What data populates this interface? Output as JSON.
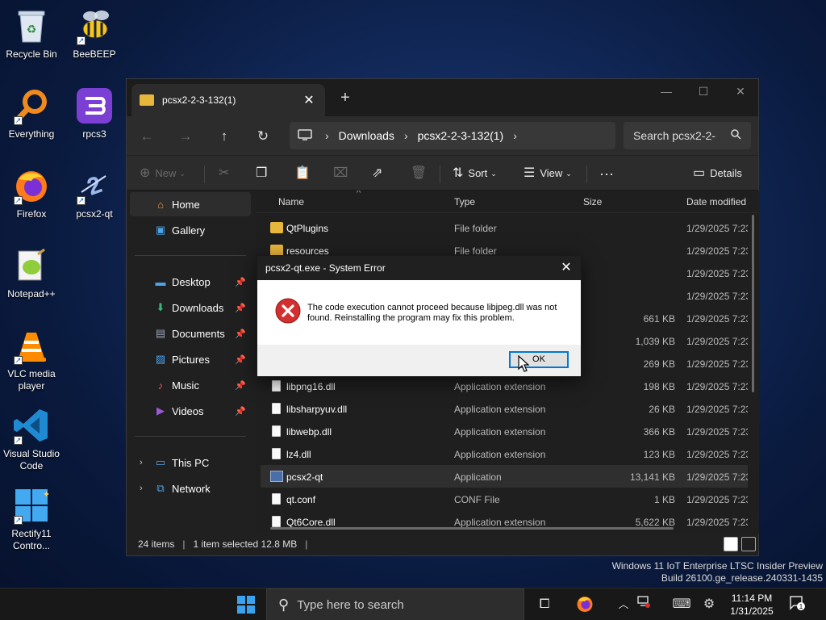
{
  "desktop": {
    "icons": [
      {
        "label": "Recycle Bin",
        "icon": "recycle-bin-icon"
      },
      {
        "label": "BeeBEEP",
        "icon": "beebeep-icon"
      },
      {
        "label": "Everything",
        "icon": "everything-icon"
      },
      {
        "label": "rpcs3",
        "icon": "rpcs3-icon"
      },
      {
        "label": "Firefox",
        "icon": "firefox-icon"
      },
      {
        "label": "pcsx2-qt",
        "icon": "pcsx2-icon"
      },
      {
        "label": "Notepad++",
        "icon": "notepadpp-icon"
      },
      {
        "label": "VLC media player",
        "icon": "vlc-icon"
      },
      {
        "label": "Visual Studio Code",
        "icon": "vscode-icon"
      },
      {
        "label": "Rectify11 Contro...",
        "icon": "rectify11-icon"
      }
    ]
  },
  "explorer": {
    "tab_title": "pcsx2-2-3-132(1)",
    "address": {
      "crumbs": [
        "Downloads",
        "pcsx2-2-3-132(1)"
      ]
    },
    "search_placeholder": "Search pcsx2-2-",
    "commands": {
      "new": "New",
      "sort": "Sort",
      "view": "View",
      "details": "Details"
    },
    "sidebar": {
      "home": "Home",
      "gallery": "Gallery",
      "quick": [
        {
          "label": "Desktop",
          "icon": "desktop-icon"
        },
        {
          "label": "Downloads",
          "icon": "downloads-icon"
        },
        {
          "label": "Documents",
          "icon": "documents-icon"
        },
        {
          "label": "Pictures",
          "icon": "pictures-icon"
        },
        {
          "label": "Music",
          "icon": "music-icon"
        },
        {
          "label": "Videos",
          "icon": "videos-icon"
        }
      ],
      "this_pc": "This PC",
      "network": "Network"
    },
    "columns": {
      "name": "Name",
      "type": "Type",
      "size": "Size",
      "date": "Date modified"
    },
    "rows": [
      {
        "name": "QtPlugins",
        "type": "File folder",
        "size": "",
        "date": "1/29/2025 7:23",
        "kind": "folder"
      },
      {
        "name": "resources",
        "type": "File folder",
        "size": "",
        "date": "1/29/2025 7:23",
        "kind": "folder"
      },
      {
        "name": "",
        "type": "",
        "size": "",
        "date": "1/29/2025 7:23",
        "kind": "hidden"
      },
      {
        "name": "",
        "type": "",
        "size": "",
        "date": "1/29/2025 7:23",
        "kind": "hidden"
      },
      {
        "name": "",
        "type": "",
        "size": "661 KB",
        "date": "1/29/2025 7:23",
        "kind": "hidden"
      },
      {
        "name": "",
        "type": "",
        "size": "1,039 KB",
        "date": "1/29/2025 7:23",
        "kind": "hidden"
      },
      {
        "name": "",
        "type": "",
        "size": "269 KB",
        "date": "1/29/2025 7:23",
        "kind": "hidden"
      },
      {
        "name": "libpng16.dll",
        "type": "Application extension",
        "size": "198 KB",
        "date": "1/29/2025 7:23",
        "kind": "file"
      },
      {
        "name": "libsharpyuv.dll",
        "type": "Application extension",
        "size": "26 KB",
        "date": "1/29/2025 7:23",
        "kind": "file"
      },
      {
        "name": "libwebp.dll",
        "type": "Application extension",
        "size": "366 KB",
        "date": "1/29/2025 7:23",
        "kind": "file"
      },
      {
        "name": "lz4.dll",
        "type": "Application extension",
        "size": "123 KB",
        "date": "1/29/2025 7:23",
        "kind": "file"
      },
      {
        "name": "pcsx2-qt",
        "type": "Application",
        "size": "13,141 KB",
        "date": "1/29/2025 7:23",
        "kind": "app"
      },
      {
        "name": "qt.conf",
        "type": "CONF File",
        "size": "1 KB",
        "date": "1/29/2025 7:23",
        "kind": "file"
      },
      {
        "name": "Qt6Core.dll",
        "type": "Application extension",
        "size": "5,622 KB",
        "date": "1/29/2025 7:23",
        "kind": "file"
      }
    ],
    "status": {
      "items": "24 items",
      "selected": "1 item selected  12.8 MB"
    }
  },
  "dialog": {
    "title": "pcsx2-qt.exe - System Error",
    "message": "The code execution cannot proceed because libjpeg.dll was not found. Reinstalling the program may fix this problem.",
    "ok": "OK"
  },
  "watermark": {
    "line1": "Windows 11 IoT Enterprise LTSC Insider Preview",
    "line2": "Build 26100.ge_release.240331-1435"
  },
  "taskbar": {
    "search_placeholder": "Type here to search",
    "time": "11:14 PM",
    "date": "1/31/2025",
    "notification_count": "1"
  },
  "colors": {
    "accent": "#0078d7",
    "folder": "#e8b63b",
    "error": "#d32f2f"
  }
}
